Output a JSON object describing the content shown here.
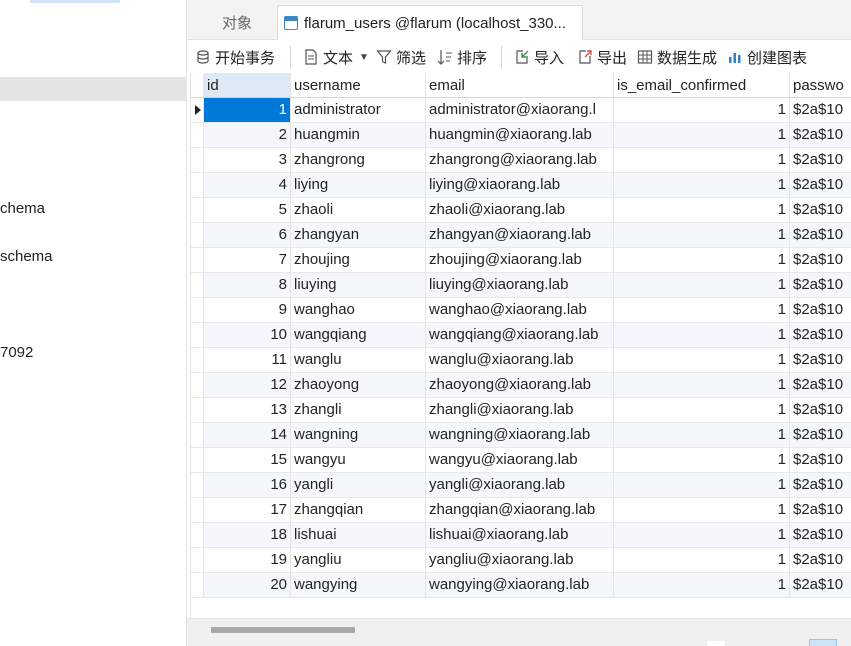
{
  "sidebar": {
    "items": [
      {
        "label": "chema"
      },
      {
        "label": "schema"
      },
      {
        "label": "7092"
      }
    ]
  },
  "tabs": {
    "objects_label": "对象",
    "active_label": "flarum_users @flarum (localhost_330..."
  },
  "toolbar": {
    "begin_transaction": "开始事务",
    "text": "文本",
    "filter": "筛选",
    "sort": "排序",
    "import": "导入",
    "export": "导出",
    "data_generation": "数据生成",
    "create_chart": "创建图表"
  },
  "grid": {
    "columns": [
      "id",
      "username",
      "email",
      "is_email_confirmed",
      "passwo"
    ],
    "rows": [
      {
        "id": "1",
        "username": "administrator",
        "email": "administrator@xiaorang.l",
        "confirmed": "1",
        "password": "$2a$10"
      },
      {
        "id": "2",
        "username": "huangmin",
        "email": "huangmin@xiaorang.lab",
        "confirmed": "1",
        "password": "$2a$10"
      },
      {
        "id": "3",
        "username": "zhangrong",
        "email": "zhangrong@xiaorang.lab",
        "confirmed": "1",
        "password": "$2a$10"
      },
      {
        "id": "4",
        "username": "liying",
        "email": "liying@xiaorang.lab",
        "confirmed": "1",
        "password": "$2a$10"
      },
      {
        "id": "5",
        "username": "zhaoli",
        "email": "zhaoli@xiaorang.lab",
        "confirmed": "1",
        "password": "$2a$10"
      },
      {
        "id": "6",
        "username": "zhangyan",
        "email": "zhangyan@xiaorang.lab",
        "confirmed": "1",
        "password": "$2a$10"
      },
      {
        "id": "7",
        "username": "zhoujing",
        "email": "zhoujing@xiaorang.lab",
        "confirmed": "1",
        "password": "$2a$10"
      },
      {
        "id": "8",
        "username": "liuying",
        "email": "liuying@xiaorang.lab",
        "confirmed": "1",
        "password": "$2a$10"
      },
      {
        "id": "9",
        "username": "wanghao",
        "email": "wanghao@xiaorang.lab",
        "confirmed": "1",
        "password": "$2a$10"
      },
      {
        "id": "10",
        "username": "wangqiang",
        "email": "wangqiang@xiaorang.lab",
        "confirmed": "1",
        "password": "$2a$10"
      },
      {
        "id": "11",
        "username": "wanglu",
        "email": "wanglu@xiaorang.lab",
        "confirmed": "1",
        "password": "$2a$10"
      },
      {
        "id": "12",
        "username": "zhaoyong",
        "email": "zhaoyong@xiaorang.lab",
        "confirmed": "1",
        "password": "$2a$10"
      },
      {
        "id": "13",
        "username": "zhangli",
        "email": "zhangli@xiaorang.lab",
        "confirmed": "1",
        "password": "$2a$10"
      },
      {
        "id": "14",
        "username": "wangning",
        "email": "wangning@xiaorang.lab",
        "confirmed": "1",
        "password": "$2a$10"
      },
      {
        "id": "15",
        "username": "wangyu",
        "email": "wangyu@xiaorang.lab",
        "confirmed": "1",
        "password": "$2a$10"
      },
      {
        "id": "16",
        "username": "yangli",
        "email": "yangli@xiaorang.lab",
        "confirmed": "1",
        "password": "$2a$10"
      },
      {
        "id": "17",
        "username": "zhangqian",
        "email": "zhangqian@xiaorang.lab",
        "confirmed": "1",
        "password": "$2a$10"
      },
      {
        "id": "18",
        "username": "lishuai",
        "email": "lishuai@xiaorang.lab",
        "confirmed": "1",
        "password": "$2a$10"
      },
      {
        "id": "19",
        "username": "yangliu",
        "email": "yangliu@xiaorang.lab",
        "confirmed": "1",
        "password": "$2a$10"
      },
      {
        "id": "20",
        "username": "wangying",
        "email": "wangying@xiaorang.lab",
        "confirmed": "1",
        "password": "$2a$10"
      }
    ]
  },
  "colors": {
    "selection": "#0078d7",
    "alt_row": "#f4f8fd",
    "header_id": "#dfe9f6"
  },
  "icons": {
    "begin_transaction": "database-icon",
    "text": "document-icon",
    "filter": "funnel-icon",
    "sort": "sort-icon",
    "import": "import-icon",
    "export": "export-icon",
    "data_generation": "data-generation-icon",
    "create_chart": "chart-icon"
  }
}
